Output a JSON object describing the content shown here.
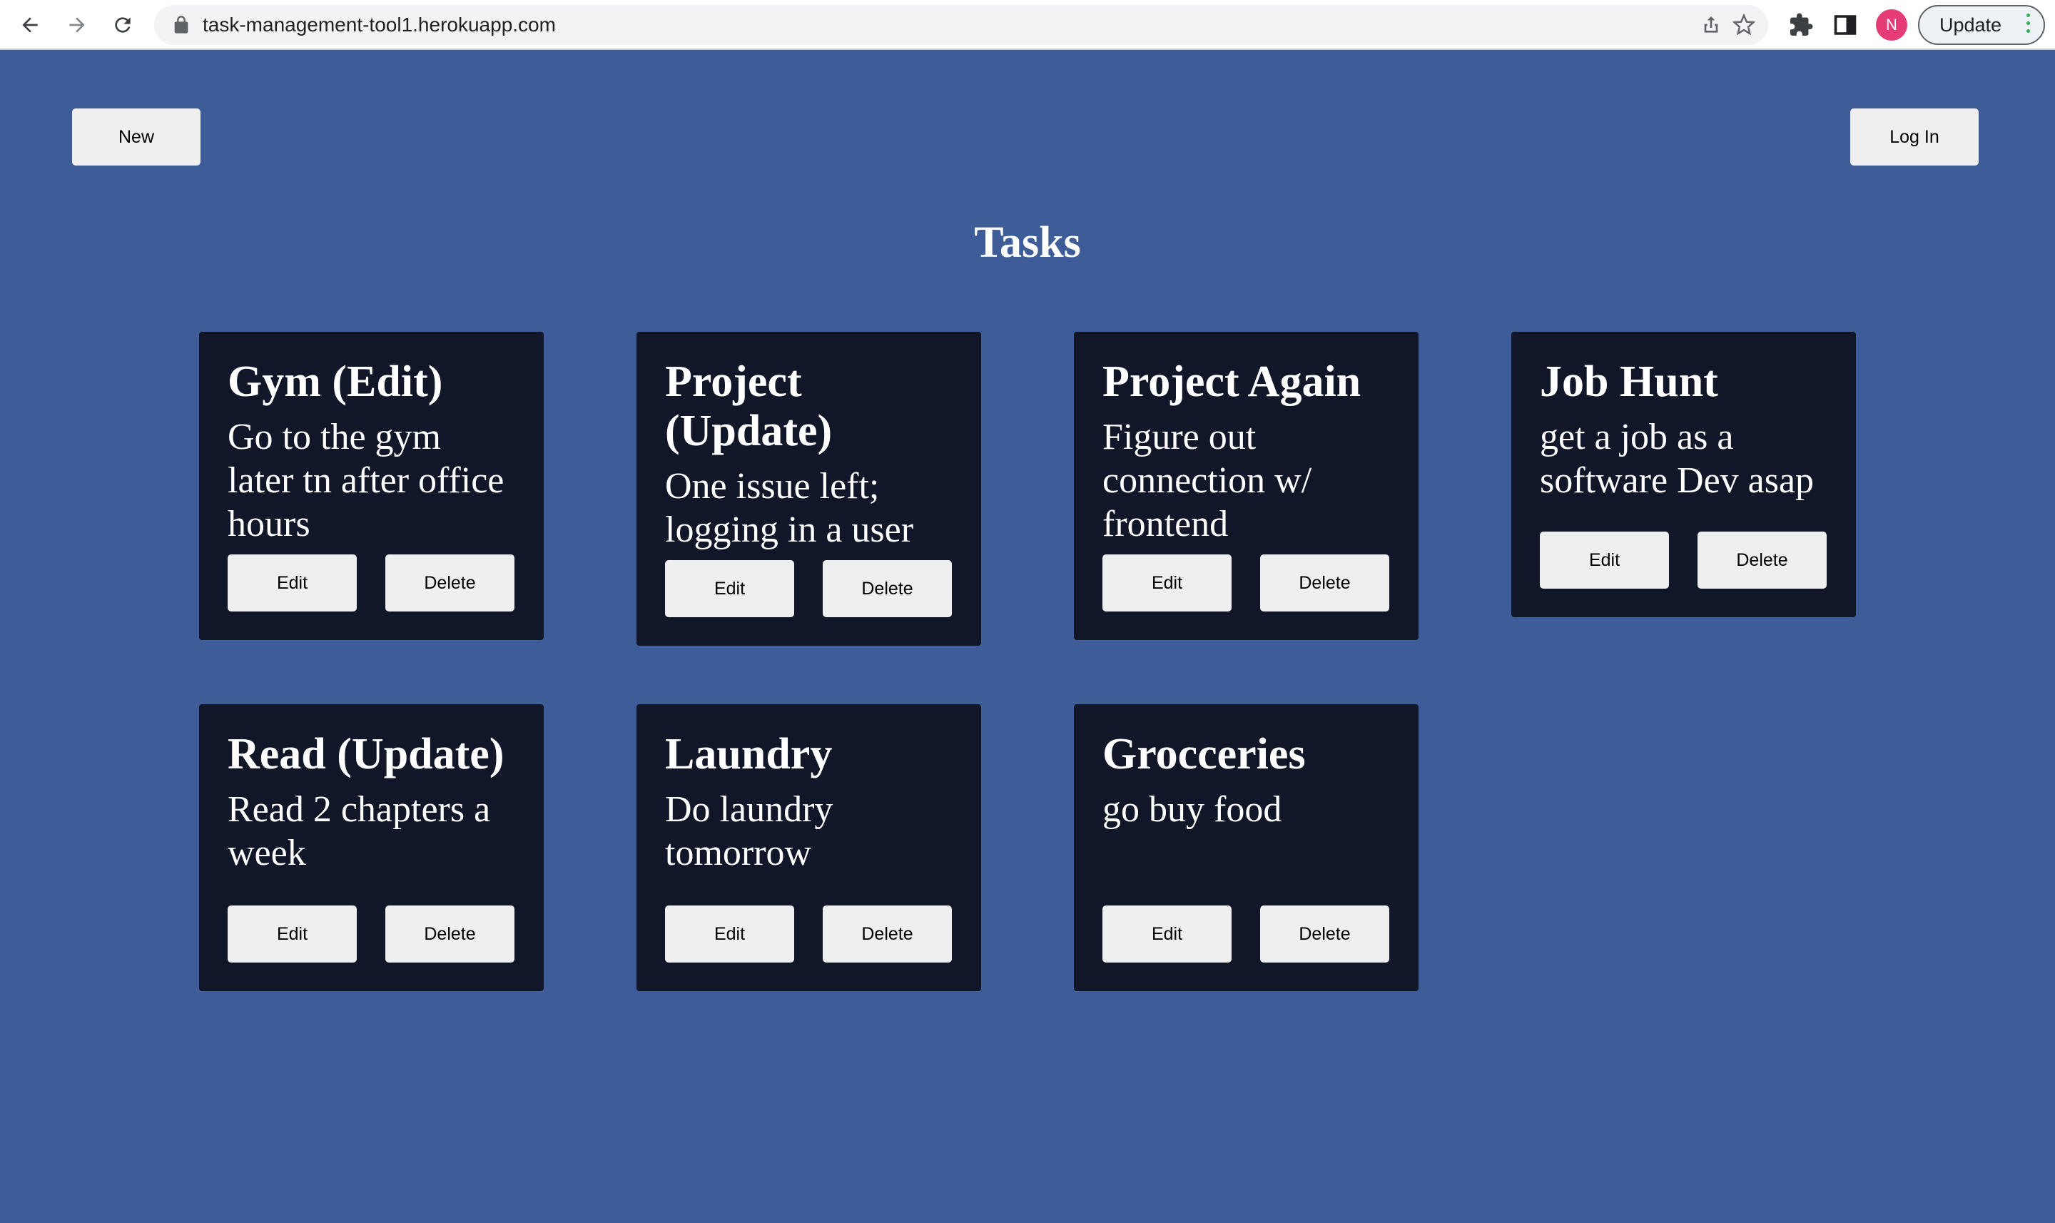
{
  "browser": {
    "url": "task-management-tool1.herokuapp.com",
    "profile_initial": "N",
    "update_label": "Update",
    "icons": [
      "back-arrow-icon",
      "forward-arrow-icon",
      "reload-icon",
      "lock-icon",
      "share-icon",
      "star-icon",
      "puzzle-icon",
      "side-panel-icon"
    ]
  },
  "header": {
    "new_label": "New",
    "login_label": "Log In"
  },
  "page": {
    "title": "Tasks"
  },
  "tasks": [
    {
      "title": "Gym (Edit)",
      "description": "Go to the gym later tn after office hours",
      "edit_label": "Edit",
      "delete_label": "Delete"
    },
    {
      "title": "Project (Update)",
      "description": "One issue left; logging in a user",
      "edit_label": "Edit",
      "delete_label": "Delete"
    },
    {
      "title": "Project Again",
      "description": "Figure out connection w/ frontend",
      "edit_label": "Edit",
      "delete_label": "Delete"
    },
    {
      "title": "Job Hunt",
      "description": "get a job as a software Dev asap",
      "edit_label": "Edit",
      "delete_label": "Delete"
    },
    {
      "title": "Read (Update)",
      "description": "Read 2 chapters a week",
      "edit_label": "Edit",
      "delete_label": "Delete"
    },
    {
      "title": "Laundry",
      "description": "Do laundry tomorrow",
      "edit_label": "Edit",
      "delete_label": "Delete"
    },
    {
      "title": "Grocceries",
      "description": "go buy food",
      "edit_label": "Edit",
      "delete_label": "Delete"
    }
  ],
  "colors": {
    "page_background": "#3e5c98",
    "card_background": "#111729",
    "button_background": "#efefef",
    "profile_avatar": "#e53c78"
  }
}
